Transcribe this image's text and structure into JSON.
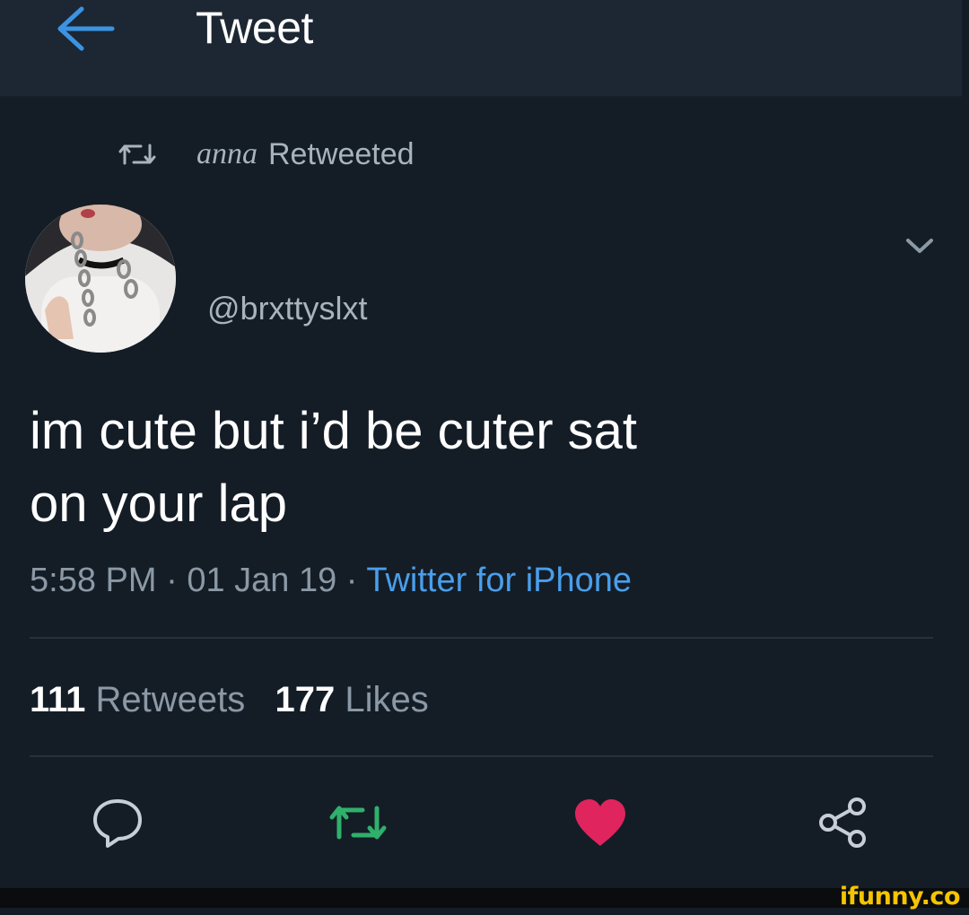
{
  "header": {
    "title": "Tweet",
    "back_icon": "arrow-left-icon"
  },
  "retweet_context": {
    "icon": "retweet-icon",
    "name": "anna",
    "suffix": "Retweeted"
  },
  "author": {
    "handle": "@brxttyslxt",
    "avatar_icon": "avatar-photo"
  },
  "tweet": {
    "text": "im cute but i’d be cuter sat\non your lap",
    "time": "5:58 PM",
    "date": "01 Jan 19",
    "separator": " · ",
    "source": "Twitter for iPhone"
  },
  "stats": {
    "retweets_count": "111",
    "retweets_label": "Retweets",
    "likes_count": "177",
    "likes_label": "Likes"
  },
  "actions": [
    {
      "name": "reply",
      "icon": "reply-icon"
    },
    {
      "name": "retweet",
      "icon": "retweet-icon",
      "active": true,
      "color": "#2fb06b"
    },
    {
      "name": "like",
      "icon": "heart-icon",
      "active": true,
      "color": "#e0245e"
    },
    {
      "name": "share",
      "icon": "share-icon"
    }
  ],
  "colors": {
    "background": "#141d26",
    "header": "#1d2733",
    "accent_blue": "#4a9eeb",
    "muted_text": "#8b98a5",
    "retweet_green": "#2fb06b",
    "like_red": "#e0245e"
  },
  "watermark": {
    "text": "ifunny.co"
  }
}
